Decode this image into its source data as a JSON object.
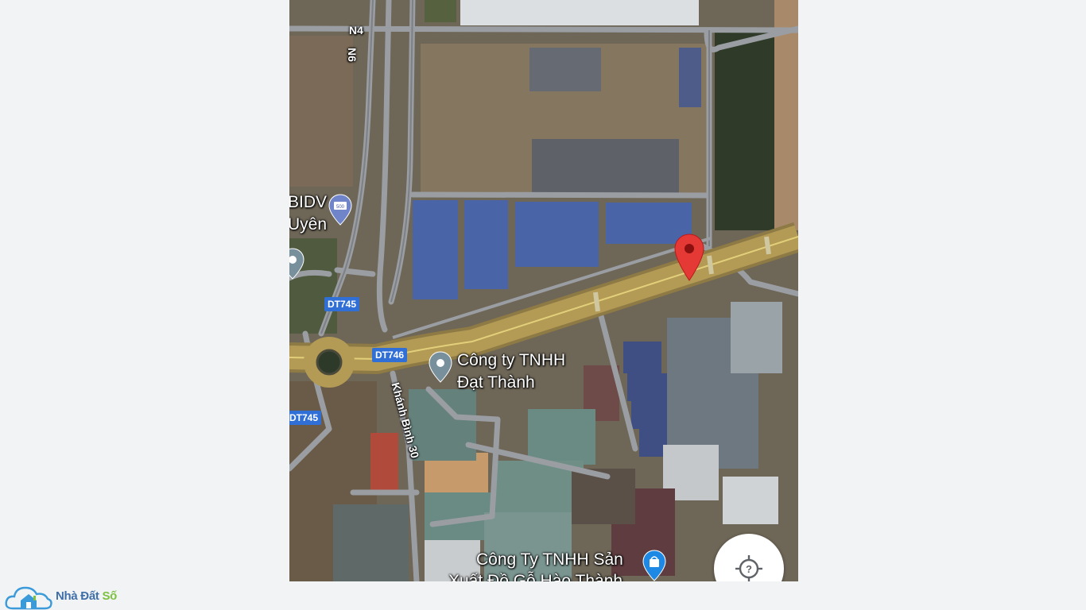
{
  "map": {
    "labels": {
      "bidv_line1": "BIDV",
      "bidv_line2": "Uyên",
      "company1_line1": "Công ty TNHH",
      "company1_line2": "Đạt Thành",
      "company2_line1": "Công Ty TNHH Sản",
      "company2_line2": "Xuất Đồ Gỗ Hào Thành"
    },
    "roads": {
      "n4": "N4",
      "n6": "N6",
      "khanh_binh": "Khánh Bình 30"
    },
    "shields": {
      "dt745_top": "DT745",
      "dt746": "DT746",
      "dt745_left": "DT745"
    },
    "bank_badge": "500",
    "marker_color": "#e53935",
    "road_highlight_color": "#b39a55",
    "shield_color": "#2f6fd6"
  },
  "controls": {
    "locate_symbol": "?"
  },
  "brand": {
    "name_part1": "Nhà Đất",
    "name_part2": "Số",
    "color_primary": "#3f6fa8",
    "color_accent": "#7cc142"
  }
}
